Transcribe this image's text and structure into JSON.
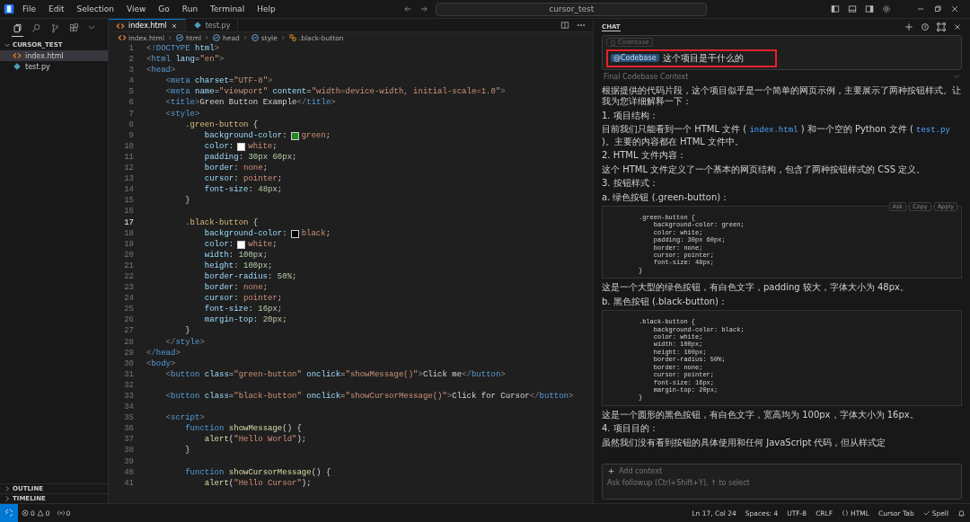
{
  "titlebar": {
    "menus": [
      "File",
      "Edit",
      "Selection",
      "View",
      "Go",
      "Run",
      "Terminal",
      "Help"
    ],
    "search": "cursor_test"
  },
  "sidebar": {
    "tools": [
      {
        "kind": "files",
        "selected": true
      },
      {
        "kind": "search",
        "selected": false
      },
      {
        "kind": "branch",
        "selected": false
      },
      {
        "kind": "extensions",
        "selected": false
      }
    ],
    "folder": {
      "label": "CURSOR_TEST",
      "expanded": true,
      "files": [
        {
          "label": "index.html",
          "kind": "html",
          "selected": true
        },
        {
          "label": "test.py",
          "kind": "py",
          "selected": false
        }
      ]
    },
    "sections": [
      {
        "label": "OUTLINE",
        "expanded": false
      },
      {
        "label": "TIMELINE",
        "expanded": false
      }
    ]
  },
  "editor": {
    "tabs": [
      {
        "label": "index.html",
        "kind": "html",
        "selected": true
      },
      {
        "label": "test.py",
        "kind": "py",
        "selected": false
      }
    ],
    "breadcrumbs": [
      {
        "label": "index.html",
        "kind": "html"
      },
      {
        "label": "html",
        "kind": "tag"
      },
      {
        "label": "head",
        "kind": "tag"
      },
      {
        "label": "style",
        "kind": "tag"
      },
      {
        "label": ".black-button",
        "kind": "rule"
      }
    ],
    "lines": [
      {
        "n": "1",
        "current": false,
        "text": "<!DOCTYPE html>"
      },
      {
        "n": "2",
        "current": false,
        "text": "<html lang=\"en\">"
      },
      {
        "n": "3",
        "current": false,
        "text": "<head>"
      },
      {
        "n": "4",
        "current": false,
        "text": "    <meta charset=\"UTF-8\">"
      },
      {
        "n": "5",
        "current": false,
        "text": "    <meta name=\"viewport\" content=\"width=device-width, initial-scale=1.0\">"
      },
      {
        "n": "6",
        "current": false,
        "text": "    <title>Green Button Example</title>"
      },
      {
        "n": "7",
        "current": false,
        "text": "    <style>"
      },
      {
        "n": "8",
        "current": false,
        "text": "        .green-button {"
      },
      {
        "n": "9",
        "current": false,
        "text": "            background-color:",
        "color": "#1f8a1f",
        "value": "green;"
      },
      {
        "n": "10",
        "current": false,
        "text": "            color:",
        "color": "#ffffff",
        "value": "white;"
      },
      {
        "n": "11",
        "current": false,
        "text": "            padding: 30px 60px;"
      },
      {
        "n": "12",
        "current": false,
        "text": "            border: none;"
      },
      {
        "n": "13",
        "current": false,
        "text": "            cursor: pointer;"
      },
      {
        "n": "14",
        "current": false,
        "text": "            font-size: 48px;"
      },
      {
        "n": "15",
        "current": false,
        "text": "        }"
      },
      {
        "n": "16",
        "current": false
      },
      {
        "n": "17",
        "current": true,
        "text": "        .black-button {"
      },
      {
        "n": "18",
        "current": false,
        "text": "            background-color:",
        "color": "#000000",
        "value": "black;"
      },
      {
        "n": "19",
        "current": false,
        "text": "            color:",
        "color": "#ffffff",
        "value": "white;"
      },
      {
        "n": "20",
        "current": false,
        "text": "            width: 100px;"
      },
      {
        "n": "21",
        "current": false,
        "text": "            height: 100px;"
      },
      {
        "n": "22",
        "current": false,
        "text": "            border-radius: 50%;"
      },
      {
        "n": "23",
        "current": false,
        "text": "            border: none;"
      },
      {
        "n": "24",
        "current": false,
        "text": "            cursor: pointer;"
      },
      {
        "n": "25",
        "current": false,
        "text": "            font-size: 16px;"
      },
      {
        "n": "26",
        "current": false,
        "text": "            margin-top: 20px;"
      },
      {
        "n": "27",
        "current": false,
        "text": "        }"
      },
      {
        "n": "28",
        "current": false,
        "text": "    </style>"
      },
      {
        "n": "29",
        "current": false,
        "text": "</head>"
      },
      {
        "n": "30",
        "current": false,
        "text": "<body>"
      },
      {
        "n": "31",
        "current": false,
        "text": "    <button class=\"green-button\" onclick=\"showMessage()\">Click me</button>"
      },
      {
        "n": "32",
        "current": false
      },
      {
        "n": "33",
        "current": false,
        "text": "    <button class=\"black-button\" onclick=\"showCursorMessage()\">Click for Cursor</button>"
      },
      {
        "n": "34",
        "current": false
      },
      {
        "n": "35",
        "current": false,
        "text": "    <script>"
      },
      {
        "n": "36",
        "current": false,
        "text": "        function showMessage() {"
      },
      {
        "n": "37",
        "current": false,
        "text": "            alert(\"Hello World\");"
      },
      {
        "n": "38",
        "current": false,
        "text": "        }"
      },
      {
        "n": "39",
        "current": false
      },
      {
        "n": "40",
        "current": false,
        "text": "        function showCursorMessage() {"
      },
      {
        "n": "41",
        "current": false,
        "text": "            alert(\"Hello Cursor\");"
      }
    ]
  },
  "chat": {
    "title": "CHAT",
    "query": {
      "context_chip": "Codebase",
      "mention": "@Codebase",
      "text": "这个项目是干什么的",
      "highlighted": true
    },
    "context_label": "Final Codebase Context",
    "messages": [
      {
        "kind": "p",
        "text": "根据提供的代码片段，这个项目似乎是一个简单的网页示例，主要展示了两种按钮样式。让我为您详细解释一下："
      },
      {
        "kind": "p",
        "text": "1. 项目结构："
      },
      {
        "kind": "p",
        "parts": [
          {
            "kind": "text",
            "text": "目前我们只能看到一个 HTML 文件 ( "
          },
          {
            "kind": "code",
            "text": "index.html"
          },
          {
            "kind": "text",
            "text": " ) 和一个空的 Python 文件 ( "
          },
          {
            "kind": "code",
            "text": "test.py"
          },
          {
            "kind": "text",
            "text": " )。主要的内容都在 HTML 文件中。"
          }
        ]
      },
      {
        "kind": "p",
        "text": "2. HTML 文件内容："
      },
      {
        "kind": "p",
        "text": "这个 HTML 文件定义了一个基本的网页结构，包含了两种按钮样式的 CSS 定义。"
      },
      {
        "kind": "p",
        "text": "3. 按钮样式："
      },
      {
        "kind": "p",
        "text": "a. 绿色按钮 (.green-button)："
      },
      {
        "kind": "code",
        "actions": [
          "Ask",
          "Copy",
          "Apply"
        ],
        "lines": [
          ".green-button {",
          "    background-color: green;",
          "    color: white;",
          "    padding: 30px 60px;",
          "    border: none;",
          "    cursor: pointer;",
          "    font-size: 48px;",
          "}"
        ]
      },
      {
        "kind": "p",
        "text": "这是一个大型的绿色按钮，有白色文字，padding 较大，字体大小为 48px。"
      },
      {
        "kind": "p",
        "text": "b. 黑色按钮 (.black-button)："
      },
      {
        "kind": "code",
        "lines": [
          ".black-button {",
          "    background-color: black;",
          "    color: white;",
          "    width: 100px;",
          "    height: 100px;",
          "    border-radius: 50%;",
          "    border: none;",
          "    cursor: pointer;",
          "    font-size: 16px;",
          "    margin-top: 20px;",
          "}"
        ]
      },
      {
        "kind": "p",
        "text": "这是一个圆形的黑色按钮，有白色文字，宽高均为 100px，字体大小为 16px。"
      },
      {
        "kind": "p",
        "text": "4. 项目目的："
      },
      {
        "kind": "p",
        "text": "虽然我们没有看到按钮的具体使用和任何 JavaScript 代码，但从样式定"
      }
    ],
    "input": {
      "add_context": "Add context",
      "placeholder": "Ask followup (Ctrl+Shift+Y), ↑ to select"
    }
  },
  "status_bar": {
    "errors": "0",
    "warnings": "0",
    "ports": "0",
    "items": [
      {
        "kind": "text",
        "label": "Ln 17, Col 24"
      },
      {
        "kind": "text",
        "label": "Spaces: 4"
      },
      {
        "kind": "text",
        "label": "UTF-8"
      },
      {
        "kind": "text",
        "label": "CRLF"
      },
      {
        "kind": "language",
        "label": "HTML"
      },
      {
        "kind": "text",
        "label": "Cursor Tab"
      },
      {
        "kind": "spell",
        "label": "Spell"
      }
    ]
  }
}
